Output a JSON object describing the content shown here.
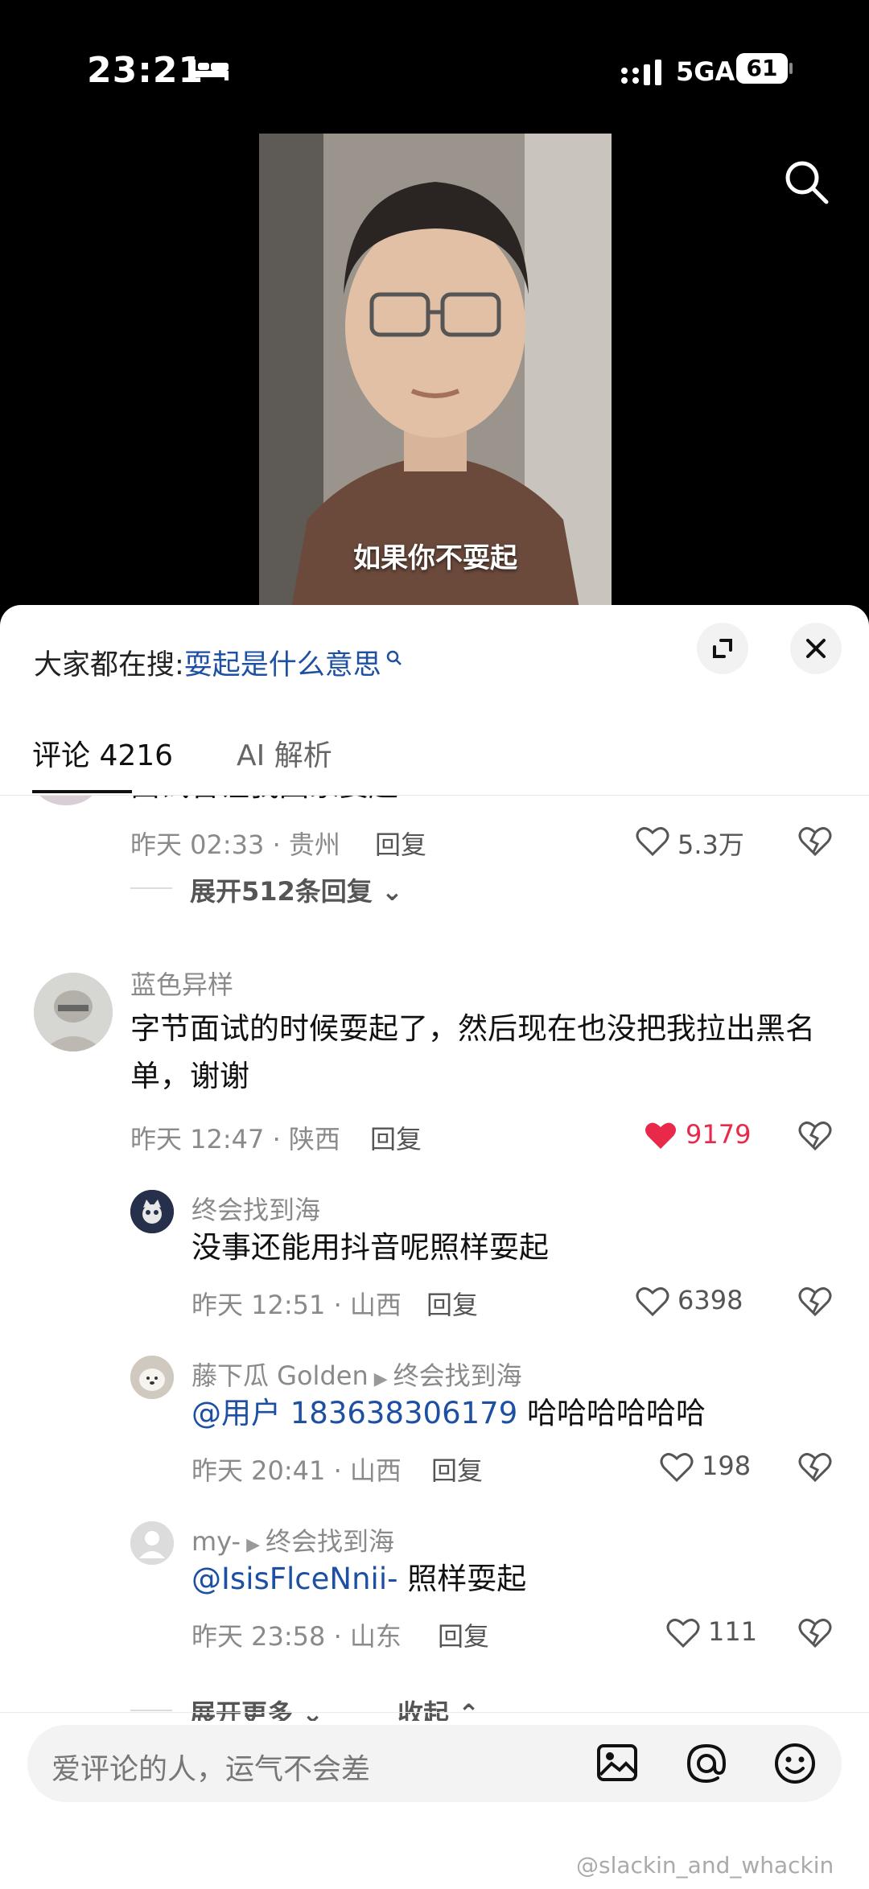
{
  "status_bar": {
    "time": "23:21",
    "network": "5GA",
    "battery": "61",
    "icons": [
      "sleep-bed-icon",
      "signal-icon",
      "battery-icon"
    ]
  },
  "video": {
    "caption": "如果你不耍起"
  },
  "sheet": {
    "search_prefix": "大家都在搜:",
    "search_keyword": "耍起是什么意思",
    "tabs": [
      {
        "label": "评论 4216"
      },
      {
        "label": "AI 解析"
      }
    ]
  },
  "comments": {
    "top_partial": {
      "text": "面试官让我回家耍起",
      "time_loc": "昨天 02:33 · 贵州",
      "reply": "回复",
      "likes": "5.3万",
      "expand": "展开512条回复"
    },
    "main": {
      "name": "蓝色异样",
      "text": "字节面试的时候耍起了，然后现在也没把我拉出黑名单，谢谢",
      "time_loc": "昨天 12:47 · 陕西",
      "reply": "回复",
      "likes": "9179"
    },
    "replies": [
      {
        "name": "终会找到海",
        "to": "",
        "mention": "",
        "text": "没事还能用抖音呢照样耍起",
        "time_loc": "昨天 12:51 · 山西",
        "reply": "回复",
        "likes": "6398"
      },
      {
        "name": "藤下瓜 Golden",
        "to": "终会找到海",
        "mention": "@用户 183638306179",
        "text": " 哈哈哈哈哈哈",
        "time_loc": "昨天 20:41 · 山西",
        "reply": "回复",
        "likes": "198"
      },
      {
        "name": "my-",
        "to": "终会找到海",
        "mention": "@IsisFlceNnii-",
        "text": " 照样耍起",
        "time_loc": "昨天 23:58 · 山东",
        "reply": "回复",
        "likes": "111"
      }
    ],
    "expand_more": "展开更多",
    "collapse": "收起"
  },
  "input": {
    "placeholder": "爱评论的人，运气不会差"
  },
  "watermark": "@slackin_and_whackin",
  "colors": {
    "accent_blue": "#1d4fa3",
    "like_red": "#e8294a"
  }
}
